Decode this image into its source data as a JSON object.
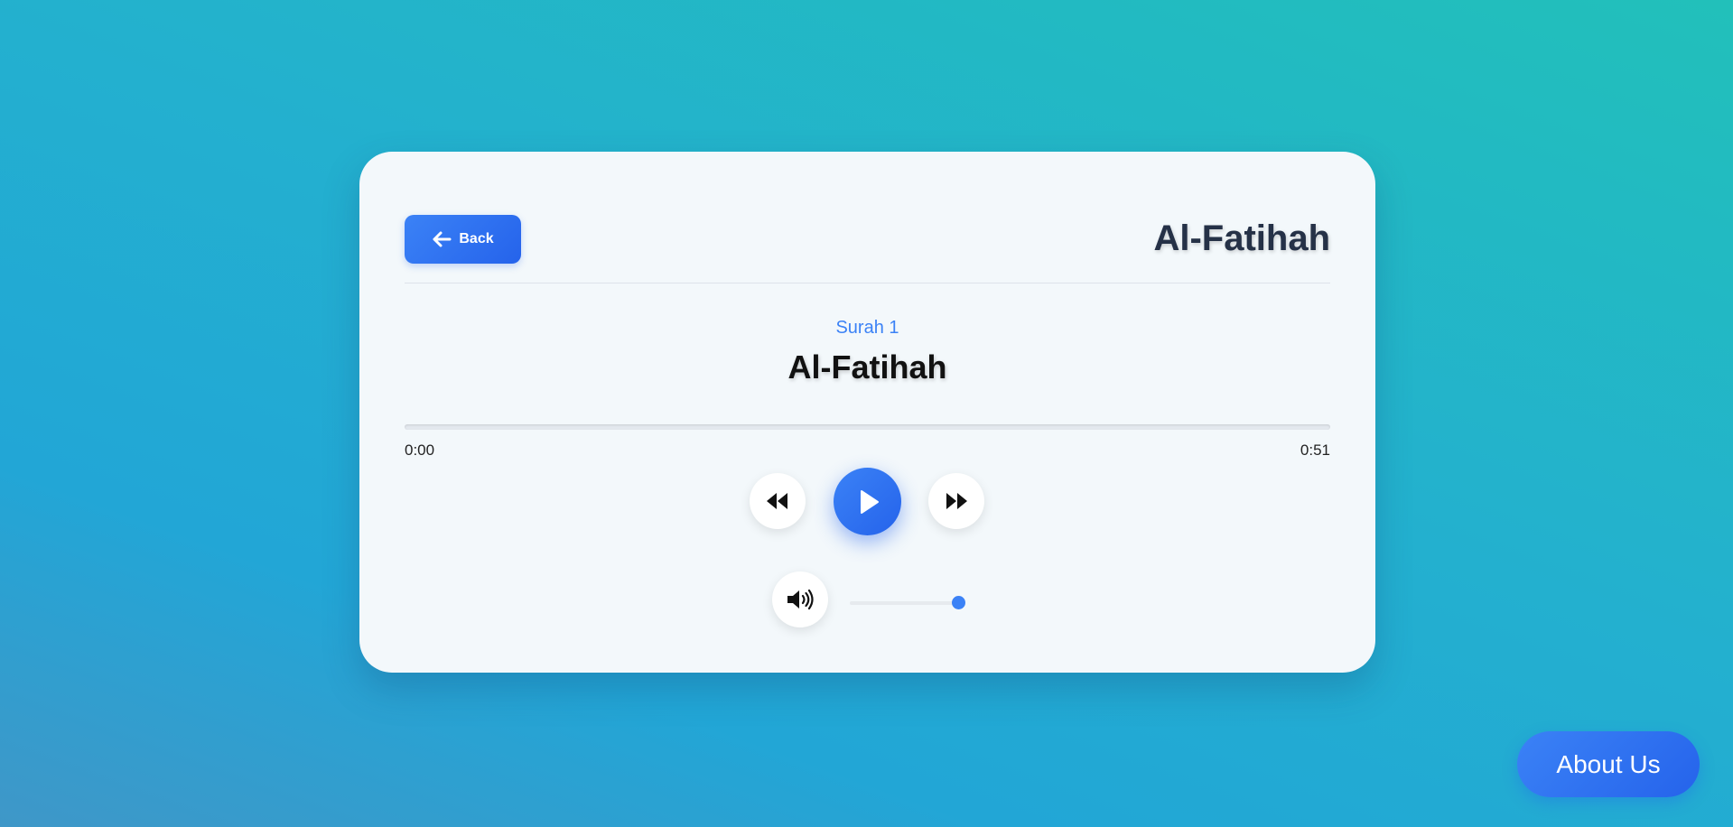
{
  "header": {
    "back_label": "Back",
    "title": "Al-Fatihah"
  },
  "surah": {
    "subtitle": "Surah 1",
    "name": "Al-Fatihah"
  },
  "player": {
    "current_time": "0:00",
    "duration": "0:51",
    "progress_fraction": 0,
    "volume_fraction": 1,
    "icons": {
      "rewind": "rewind-icon",
      "play": "play-icon",
      "forward": "fast-forward-icon",
      "volume": "volume-icon"
    }
  },
  "footer": {
    "about_label": "About Us"
  },
  "colors": {
    "accent": "#3b82f6",
    "card_background": "#f3f8fb",
    "title_text": "#253147"
  }
}
